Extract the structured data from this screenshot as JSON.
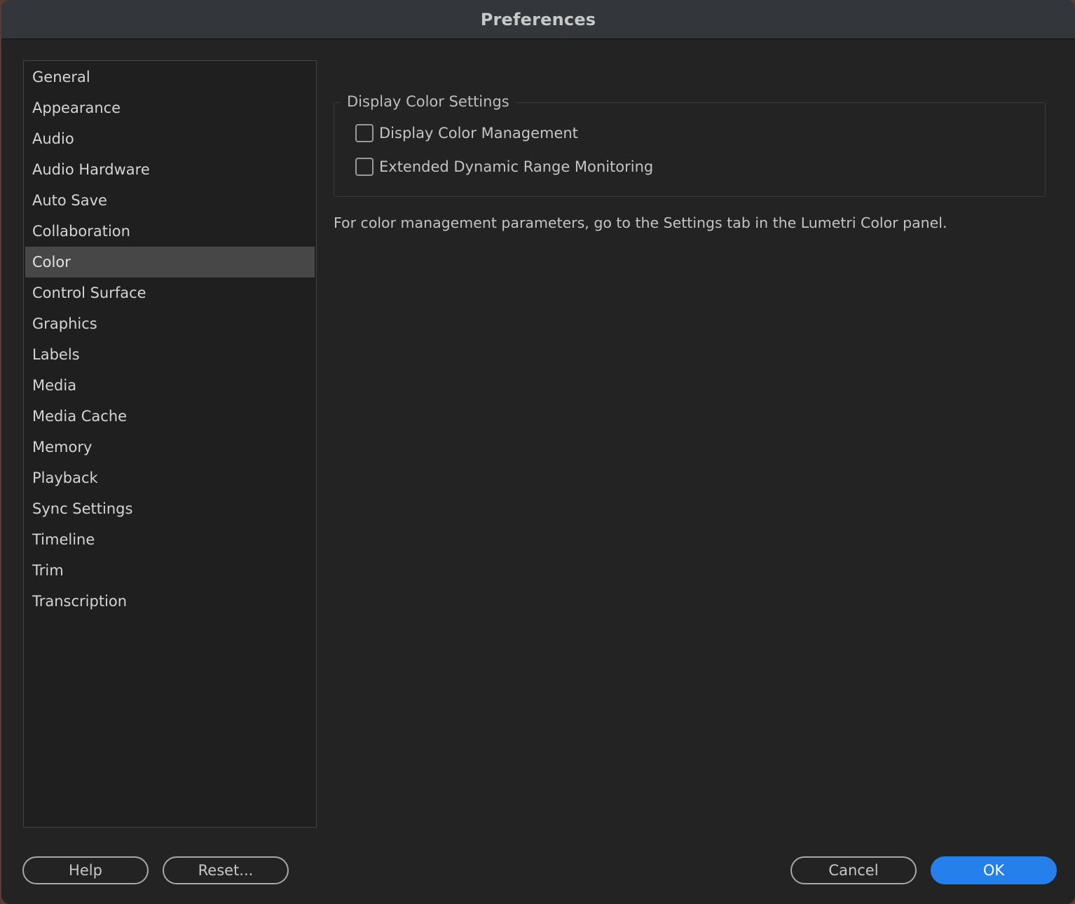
{
  "window": {
    "title": "Preferences"
  },
  "sidebar": {
    "items": [
      {
        "label": "General"
      },
      {
        "label": "Appearance"
      },
      {
        "label": "Audio"
      },
      {
        "label": "Audio Hardware"
      },
      {
        "label": "Auto Save"
      },
      {
        "label": "Collaboration"
      },
      {
        "label": "Color",
        "selected": true
      },
      {
        "label": "Control Surface"
      },
      {
        "label": "Graphics"
      },
      {
        "label": "Labels"
      },
      {
        "label": "Media"
      },
      {
        "label": "Media Cache"
      },
      {
        "label": "Memory"
      },
      {
        "label": "Playback"
      },
      {
        "label": "Sync Settings"
      },
      {
        "label": "Timeline"
      },
      {
        "label": "Trim"
      },
      {
        "label": "Transcription"
      }
    ],
    "selected_label": "Color"
  },
  "main": {
    "group_title": "Display Color Settings",
    "options": [
      {
        "label": "Display Color Management",
        "checked": false
      },
      {
        "label": "Extended Dynamic Range Monitoring",
        "checked": false
      }
    ],
    "info_text": "For color management parameters, go to the Settings tab in the Lumetri Color panel."
  },
  "footer": {
    "help_label": "Help",
    "reset_label": "Reset...",
    "cancel_label": "Cancel",
    "ok_label": "OK"
  },
  "colors": {
    "accent": "#2680eb",
    "selected_bg": "#474747",
    "window_bg": "#232323"
  }
}
